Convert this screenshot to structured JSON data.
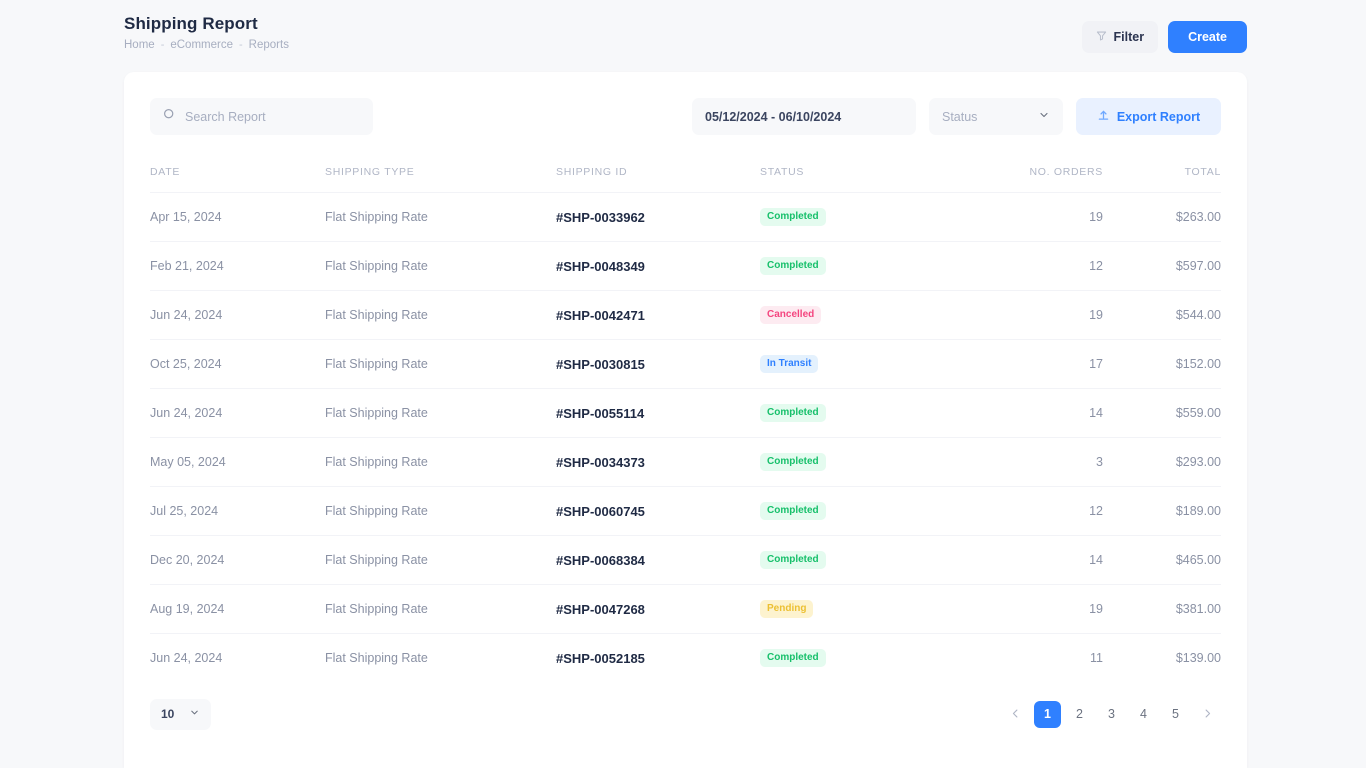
{
  "header": {
    "title": "Shipping Report",
    "breadcrumb": [
      {
        "label": "Home"
      },
      {
        "label": "eCommerce"
      },
      {
        "label": "Reports"
      }
    ],
    "separator": "-",
    "filter_label": "Filter",
    "create_label": "Create",
    "filter_icon": "funnel-icon",
    "accent_color": "#2f80ff"
  },
  "toolbar": {
    "search_placeholder": "Search Report",
    "search_value": "",
    "search_icon": "search-icon",
    "date_range": "05/12/2024 - 06/10/2024",
    "status_label": "Status",
    "status_chevron": "chevron-down-icon",
    "export_label": "Export Report",
    "export_icon": "upload-icon"
  },
  "table": {
    "columns": [
      {
        "key": "date",
        "label": "DATE"
      },
      {
        "key": "type",
        "label": "SHIPPING TYPE"
      },
      {
        "key": "id",
        "label": "SHIPPING ID"
      },
      {
        "key": "status",
        "label": "STATUS"
      },
      {
        "key": "orders",
        "label": "NO. ORDERS"
      },
      {
        "key": "total",
        "label": "TOTAL"
      }
    ],
    "rows": [
      {
        "date": "Apr 15, 2024",
        "type": "Flat Shipping Rate",
        "id": "#SHP-0033962",
        "status": "Completed",
        "status_kind": "completed",
        "orders": "19",
        "total": "$263.00"
      },
      {
        "date": "Feb 21, 2024",
        "type": "Flat Shipping Rate",
        "id": "#SHP-0048349",
        "status": "Completed",
        "status_kind": "completed",
        "orders": "12",
        "total": "$597.00"
      },
      {
        "date": "Jun 24, 2024",
        "type": "Flat Shipping Rate",
        "id": "#SHP-0042471",
        "status": "Cancelled",
        "status_kind": "cancelled",
        "orders": "19",
        "total": "$544.00"
      },
      {
        "date": "Oct 25, 2024",
        "type": "Flat Shipping Rate",
        "id": "#SHP-0030815",
        "status": "In Transit",
        "status_kind": "intransit",
        "orders": "17",
        "total": "$152.00"
      },
      {
        "date": "Jun 24, 2024",
        "type": "Flat Shipping Rate",
        "id": "#SHP-0055114",
        "status": "Completed",
        "status_kind": "completed",
        "orders": "14",
        "total": "$559.00"
      },
      {
        "date": "May 05, 2024",
        "type": "Flat Shipping Rate",
        "id": "#SHP-0034373",
        "status": "Completed",
        "status_kind": "completed",
        "orders": "3",
        "total": "$293.00"
      },
      {
        "date": "Jul 25, 2024",
        "type": "Flat Shipping Rate",
        "id": "#SHP-0060745",
        "status": "Completed",
        "status_kind": "completed",
        "orders": "12",
        "total": "$189.00"
      },
      {
        "date": "Dec 20, 2024",
        "type": "Flat Shipping Rate",
        "id": "#SHP-0068384",
        "status": "Completed",
        "status_kind": "completed",
        "orders": "14",
        "total": "$465.00"
      },
      {
        "date": "Aug 19, 2024",
        "type": "Flat Shipping Rate",
        "id": "#SHP-0047268",
        "status": "Pending",
        "status_kind": "pending",
        "orders": "19",
        "total": "$381.00"
      },
      {
        "date": "Jun 24, 2024",
        "type": "Flat Shipping Rate",
        "id": "#SHP-0052185",
        "status": "Completed",
        "status_kind": "completed",
        "orders": "11",
        "total": "$139.00"
      }
    ]
  },
  "footer": {
    "page_size": "10",
    "page_size_chevron": "chevron-down-icon",
    "prev_icon": "chevron-left-icon",
    "next_icon": "chevron-right-icon",
    "pages": [
      "1",
      "2",
      "3",
      "4",
      "5"
    ],
    "active_page": "1"
  },
  "status_colors": {
    "completed_bg": "#e4fbef",
    "completed_fg": "#17c06b",
    "cancelled_bg": "#fdebf1",
    "cancelled_fg": "#f4457f",
    "intransit_bg": "#e4f1fd",
    "intransit_fg": "#2f80ff",
    "pending_bg": "#fdf3cf",
    "pending_fg": "#ecc033"
  }
}
